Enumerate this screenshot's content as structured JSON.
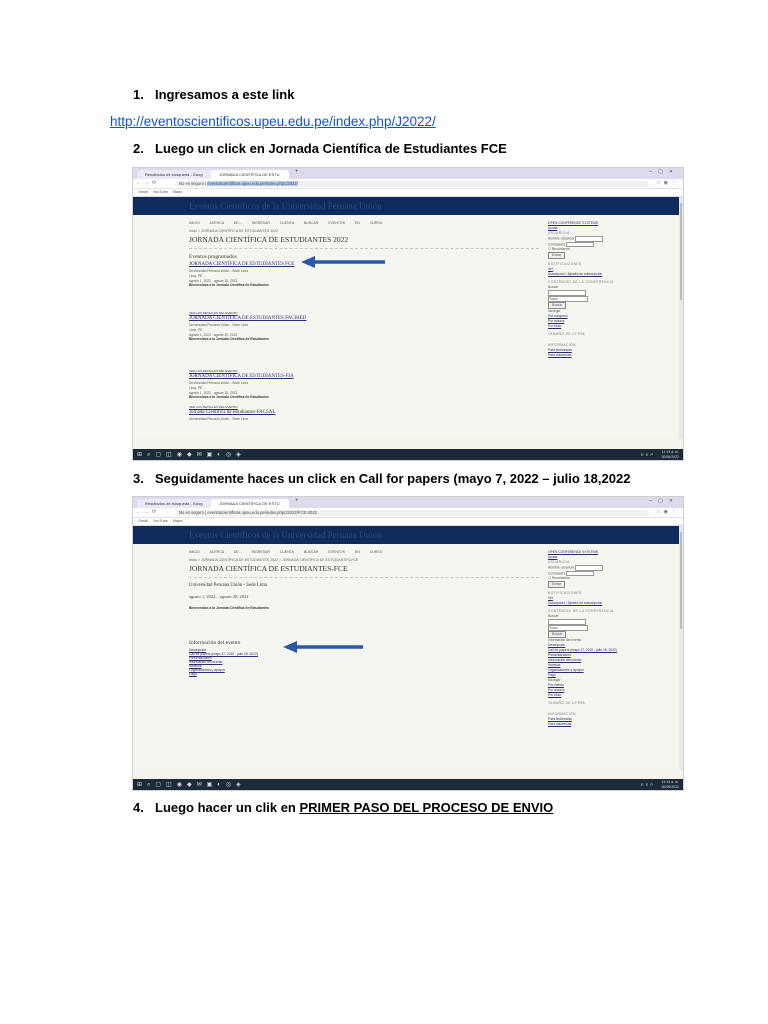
{
  "steps": [
    {
      "num": "1.",
      "text": "Ingresamos a este link"
    },
    {
      "num": "2.",
      "text": "Luego un click en Jornada Científica de Estudiantes FCE"
    },
    {
      "num": "3.",
      "text": "Seguidamente haces un click en Call for papers (mayo 7, 2022 – julio 18,2022"
    },
    {
      "num": "4.",
      "text_before": "Luego hacer un clik en ",
      "text_underlined": "PRIMER PASO DEL PROCESO DE ENVIO"
    }
  ],
  "link": "http://eventoscientificos.upeu.edu.pe/index.php/J2022/",
  "screenshot1": {
    "tabs": [
      "Resultados de búsqueda - Goog",
      "JORNADA CIENTÍFICA DE ESTU"
    ],
    "url_prefix": "No es seguro | ",
    "url": "eventoscientificos.upeu.edu.pe/index.php/J2022/",
    "bookmarks": "Gmail  YouTube  Maps",
    "site_title": "Eventos Científicos de la Universidad Peruana Unión",
    "nav": "INICIO ACERCA DE... INGRESAR CUENTA BUSCAR EVENTOS EN CURSO",
    "breadcrumb": "Inicio > JORNADA CIENTÍFICA DE ESTUDIANTES 2022",
    "page_title": "JORNADA CIENTÍFICA DE ESTUDIANTES 2022",
    "section": "Eventos programados",
    "events": [
      {
        "name": "JORNADA CIENTÍFICA DE ESTUDIANTES FCE",
        "place": "Universidad Peruana Unión - Sede Lima",
        "city": "Lima, PE",
        "dates": "agosto 1, 2022 - agosto 20, 2022",
        "welcome": "Bienvenidos a la Jornada Científica de Estudiantes"
      },
      {
        "name": "JORNADA CIENTÍFICA DE ESTUDIANTES FACIHED",
        "place": "Universidad Peruana Unión - Sede Lima",
        "city": "Lima, PE",
        "dates": "agosto 1, 2022 - agosto 20, 2022",
        "welcome": "Bienvenidos a la Jornada Científica de Estudiantes"
      },
      {
        "name": "JORNADA CIENTÍFICA DE ESTUDIANTES-FIA",
        "place": "Universidad Peruana Unión - Sede Lima",
        "city": "Lima, PE",
        "dates": "agosto 1, 2022 - agosto 20, 2022",
        "welcome": "Bienvenidos a la Jornada Científica de Estudiantes"
      },
      {
        "name": "Jornada Científica de estudiantes-FACSAL",
        "place": "Universidad Peruana Unión - Sede Lima",
        "city": "",
        "dates": "",
        "welcome": ""
      }
    ],
    "event_link": "VER LOS DETALLES DEL EVENTO",
    "sidebar": {
      "ojs": "OPEN CONFERENCE SYSTEMS",
      "help": "Ayuda",
      "user": "USUARIO/A",
      "username": "Nombre usuario/a",
      "password": "Contraseña",
      "remember": "Recordarme",
      "login": "Entrar",
      "notif": "NOTIFICACIONES",
      "notif_items": [
        "Ver",
        "Suscripción / Ajustes de subscripción"
      ],
      "search": "CONTENIDO DE LA CONFERENCIA",
      "search_label": "Buscar",
      "search_select": "Todos",
      "search_btn": "Buscar",
      "browse": "Navegar",
      "browse_items": [
        "Por congreso",
        "Por autor/a",
        "Por título"
      ],
      "font": "TAMAÑO DE LETRA",
      "info": "INFORMACIÓN",
      "info_items": [
        "Para lectores/as",
        "Para autores/as"
      ]
    },
    "taskbar_time": "11:13 a. m.",
    "taskbar_date": "30/06/2022",
    "taskbar_tray": "ESP"
  },
  "screenshot2": {
    "tabs": [
      "Resultados de búsqueda - Goog",
      "JORNADA CIENTÍFICA DE ESTU"
    ],
    "url_prefix": "No es seguro | ",
    "url": "eventoscientificos.upeu.edu.pe/index.php/J2022/FCE-2022",
    "bookmarks": "Gmail  YouTube  Maps",
    "site_title": "Eventos Científicos de la Universidad Peruana Unión",
    "nav": "INICIO ACERCA DE... INGRESAR CUENTA BUSCAR EVENTOS EN CURSO",
    "breadcrumb": "Inicio > JORNADA CIENTÍFICA DE ESTUDIANTES 2022 > JORNADA CIENTÍFICA DE ESTUDIANTES-FCE",
    "page_title": "JORNADA CIENTÍFICA DE ESTUDIANTES-FCE",
    "place": "Universidad Peruana Unión - Sede Lima",
    "dates": "agosto 1, 2022 – agosto 20, 2022",
    "welcome": "Bienvenidos a la Jornada Científica de Estudiantes",
    "info_title": "Información del evento",
    "info_items": [
      "Descripción",
      "Call for papers (mayo 17, 2022 - julio 18, 2022)",
      "Presentaciones",
      "Información del evento",
      "Horarios",
      "Organizadores y apoyos",
      "Pago"
    ],
    "sidebar": {
      "ojs": "OPEN CONFERENCE SYSTEMS",
      "help": "Ayuda",
      "user": "USUARIO/A",
      "username": "Nombre usuario/a",
      "password": "Contraseña",
      "remember": "Recordarme",
      "login": "Entrar",
      "notif": "NOTIFICACIONES",
      "notif_items": [
        "Ver",
        "Suscripción / Ajustes de subscripción"
      ],
      "search": "CONTENIDO DE LA CONFERENCIA",
      "search_label": "Buscar",
      "search_select": "Todos",
      "search_btn": "Buscar",
      "event_info": "Información del evento",
      "event_items": [
        "Descripción",
        "Call for papers (mayo 17, 2022 - julio 18, 2022)",
        "Presentaciones",
        "Información del evento",
        "Horarios",
        "Organizadores y apoyos",
        "Pago"
      ],
      "browse": "Navegar",
      "browse_items": [
        "Por evento",
        "Por autor/a",
        "Por título"
      ],
      "font": "TAMAÑO DE LETRA",
      "info": "INFORMACIÓN",
      "info_items": [
        "Para lectores/as",
        "Para autores/as"
      ]
    },
    "taskbar_time": "11:14 a. m.",
    "taskbar_date": "30/06/2022",
    "taskbar_tray": "ESP"
  },
  "colors": {
    "link": "#1155cc",
    "site_header": "#0f2a5c",
    "arrow": "#2b57a6",
    "taskbar": "#1c2a3a"
  }
}
